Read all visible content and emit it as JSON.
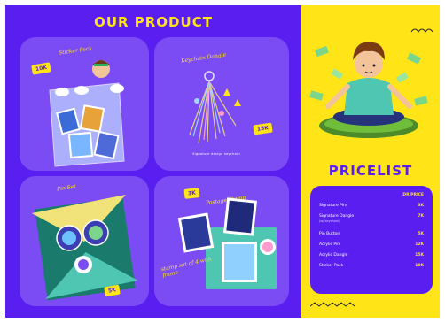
{
  "left": {
    "title": "OUR PRODUCT",
    "cards": [
      {
        "script": "Sticker Pack",
        "tag": "10K"
      },
      {
        "script": "Keychain Dangle",
        "tag": "15K",
        "caption": "Signature design keychain"
      },
      {
        "script": "Pin Set",
        "tag": "5K"
      },
      {
        "script": "Postage Stamp",
        "tag": "3K",
        "note": "stamp set of 4 with frame"
      }
    ]
  },
  "right": {
    "title": "PRICELIST",
    "header": "IDR PRICE",
    "items": [
      {
        "name": "Signature Pins",
        "price": "3K"
      },
      {
        "name": "Signature Dangle",
        "sub": "(w/ keychain)",
        "price": "7K"
      },
      {
        "name": "Pin Button",
        "price": "5K"
      },
      {
        "name": "Acrylic Pin",
        "price": "12K"
      },
      {
        "name": "Acrylic Dangle",
        "price": "15K"
      },
      {
        "name": "Sticker Pack",
        "price": "10K"
      }
    ]
  },
  "colors": {
    "purple": "#5a1ff0",
    "card_purple": "#7b4cf4",
    "yellow": "#ffe418"
  }
}
